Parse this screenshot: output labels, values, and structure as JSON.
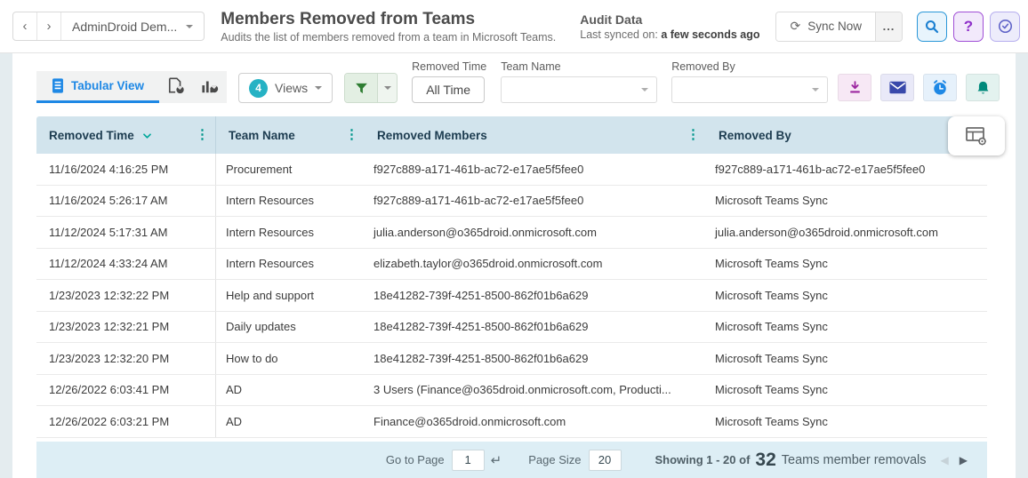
{
  "colors": {
    "accent_blue": "#1e88e5",
    "accent_teal": "#00968b",
    "views_badge_teal": "#26b2c4",
    "table_header_bg": "#d2e4ed",
    "footer_bg": "#ddeef5",
    "filter_green": "#2e7d32",
    "download_magenta": "#9c27a0",
    "mail_indigo": "#3949ab",
    "alarm_blue": "#1e88e5",
    "bell_teal": "#00897b"
  },
  "header": {
    "back": "‹",
    "forward": "›",
    "tenant": "AdminDroid Dem...",
    "title": "Members Removed from Teams",
    "subtitle": "Audits the list of members removed from a team in Microsoft Teams.",
    "audit_title": "Audit Data",
    "last_synced_label": "Last synced on:",
    "last_synced_value": "a few seconds ago",
    "sync_label": "Sync Now",
    "more_label": "..."
  },
  "toolbar": {
    "active_tab": "Tabular View",
    "views_count": "4",
    "views_label": "Views"
  },
  "filters": {
    "time": {
      "label": "Removed Time",
      "value": "All Time"
    },
    "team": {
      "label": "Team Name",
      "value": ""
    },
    "removed_by": {
      "label": "Removed By",
      "value": ""
    }
  },
  "table": {
    "columns": [
      "Removed Time",
      "Team Name",
      "Removed Members",
      "Removed By"
    ],
    "rows": [
      [
        "11/16/2024 4:16:25 PM",
        "Procurement",
        "f927c889-a171-461b-ac72-e17ae5f5fee0",
        "f927c889-a171-461b-ac72-e17ae5f5fee0"
      ],
      [
        "11/16/2024 5:26:17 AM",
        "Intern Resources",
        "f927c889-a171-461b-ac72-e17ae5f5fee0",
        "Microsoft Teams Sync"
      ],
      [
        "11/12/2024 5:17:31 AM",
        "Intern Resources",
        "julia.anderson@o365droid.onmicrosoft.com",
        "julia.anderson@o365droid.onmicrosoft.com"
      ],
      [
        "11/12/2024 4:33:24 AM",
        "Intern Resources",
        "elizabeth.taylor@o365droid.onmicrosoft.com",
        "Microsoft Teams Sync"
      ],
      [
        "1/23/2023 12:32:22 PM",
        "Help and support",
        "18e41282-739f-4251-8500-862f01b6a629",
        "Microsoft Teams Sync"
      ],
      [
        "1/23/2023 12:32:21 PM",
        "Daily updates",
        "18e41282-739f-4251-8500-862f01b6a629",
        "Microsoft Teams Sync"
      ],
      [
        "1/23/2023 12:32:20 PM",
        "How to do",
        "18e41282-739f-4251-8500-862f01b6a629",
        "Microsoft Teams Sync"
      ],
      [
        "12/26/2022 6:03:41 PM",
        "AD",
        "3 Users (Finance@o365droid.onmicrosoft.com, Producti...",
        "Microsoft Teams Sync"
      ],
      [
        "12/26/2022 6:03:21 PM",
        "AD",
        "Finance@o365droid.onmicrosoft.com",
        "Microsoft Teams Sync"
      ]
    ]
  },
  "footer": {
    "goto_label": "Go to Page",
    "goto_value": "1",
    "size_label": "Page Size",
    "size_value": "20",
    "showing_prefix": "Showing 1 - 20 of",
    "total": "32",
    "entity": "Teams member removals"
  }
}
